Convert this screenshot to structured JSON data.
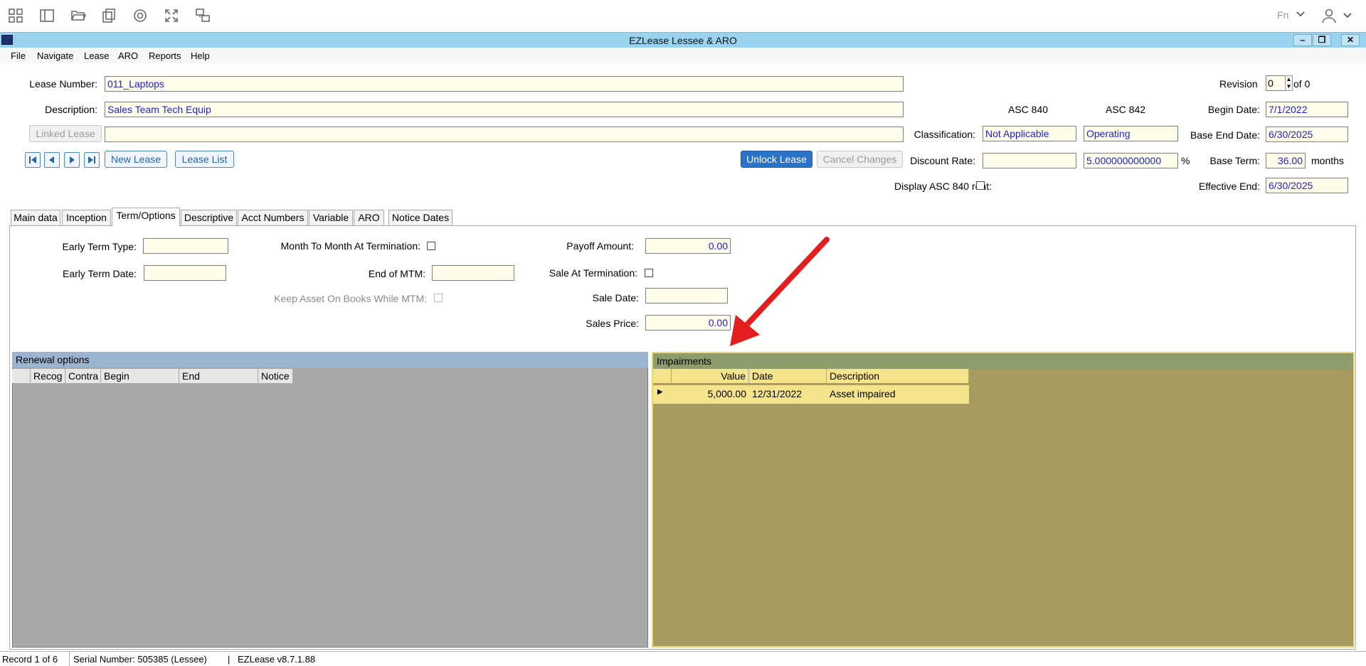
{
  "toolbar": {
    "icons": [
      "apps-grid-icon",
      "panels-icon",
      "folder-open-icon",
      "copy-icon",
      "gear-icon",
      "expand-icon",
      "remote-desktop-icon"
    ],
    "language": "Fn"
  },
  "window": {
    "title": "EZLease Lessee & ARO",
    "minimize": "‒",
    "restore": "❐",
    "close": "✕"
  },
  "menu": [
    "File",
    "Navigate",
    "Lease",
    "ARO",
    "Reports",
    "Help"
  ],
  "header": {
    "lease_number_label": "Lease Number:",
    "lease_number": "011_Laptops",
    "description_label": "Description:",
    "description": "Sales Team Tech Equip",
    "linked_lease_label": "Linked Lease",
    "linked_lease": "",
    "new_lease": "New Lease",
    "lease_list": "Lease List",
    "unlock_lease": "Unlock Lease",
    "cancel_changes": "Cancel Changes",
    "asc840_header": "ASC 840",
    "asc842_header": "ASC 842",
    "classification_label": "Classification:",
    "classification_840": "Not Applicable",
    "classification_842": "Operating",
    "discount_rate_label": "Discount Rate:",
    "discount_rate_840": "",
    "discount_rate_842": "5.000000000000",
    "percent": "%",
    "display_840_rent_label": "Display ASC 840 rent:",
    "revision_label": "Revision",
    "revision_value": "0",
    "revision_of": "of 0",
    "begin_date_label": "Begin Date:",
    "begin_date": "7/1/2022",
    "base_end_date_label": "Base End Date:",
    "base_end_date": "6/30/2025",
    "base_term_label": "Base Term:",
    "base_term": "36.00",
    "months": "months",
    "effective_end_label": "Effective End:",
    "effective_end": "6/30/2025"
  },
  "tabs": [
    "Main data",
    "Inception",
    "Term/Options",
    "Descriptive",
    "Acct Numbers",
    "Variable",
    "ARO",
    "Notice Dates"
  ],
  "active_tab": "Term/Options",
  "term_options": {
    "early_term_type_label": "Early Term Type:",
    "early_term_type": "",
    "early_term_date_label": "Early Term Date:",
    "early_term_date": "",
    "mtm_label": "Month To Month At Termination:",
    "end_of_mtm_label": "End of MTM:",
    "end_of_mtm": "",
    "keep_asset_label": "Keep Asset On Books While MTM:",
    "payoff_amount_label": "Payoff Amount:",
    "payoff_amount": "0.00",
    "sale_at_termination_label": "Sale At Termination:",
    "sale_date_label": "Sale Date:",
    "sale_date": "",
    "sales_price_label": "Sales Price:",
    "sales_price": "0.00"
  },
  "renewal_options": {
    "title": "Renewal options",
    "columns": [
      "Recog",
      "Contra",
      "Begin",
      "End",
      "Notice"
    ]
  },
  "impairments": {
    "title": "Impairments",
    "columns": [
      "Value",
      "Date",
      "Description"
    ],
    "rows": [
      {
        "value": "5,000.00",
        "date": "12/31/2022",
        "description": "Asset impaired"
      }
    ]
  },
  "status": {
    "record": "Record 1 of 6",
    "serial": "Serial Number: 505385 (Lessee)",
    "sep": "|",
    "version": "EZLease v8.7.1.88"
  },
  "colors": {
    "titlebar": "#99d3ee",
    "field_bg": "#fffde9",
    "field_text": "#1f1fd6",
    "renewal_hdr": "#9bb4cf",
    "renewal_body": "#a9a9a9",
    "impair_hdr": "#8d9d6b",
    "impair_body": "#a59b5f",
    "impair_row": "#f6e48d",
    "arrow": "#e41e1e"
  }
}
